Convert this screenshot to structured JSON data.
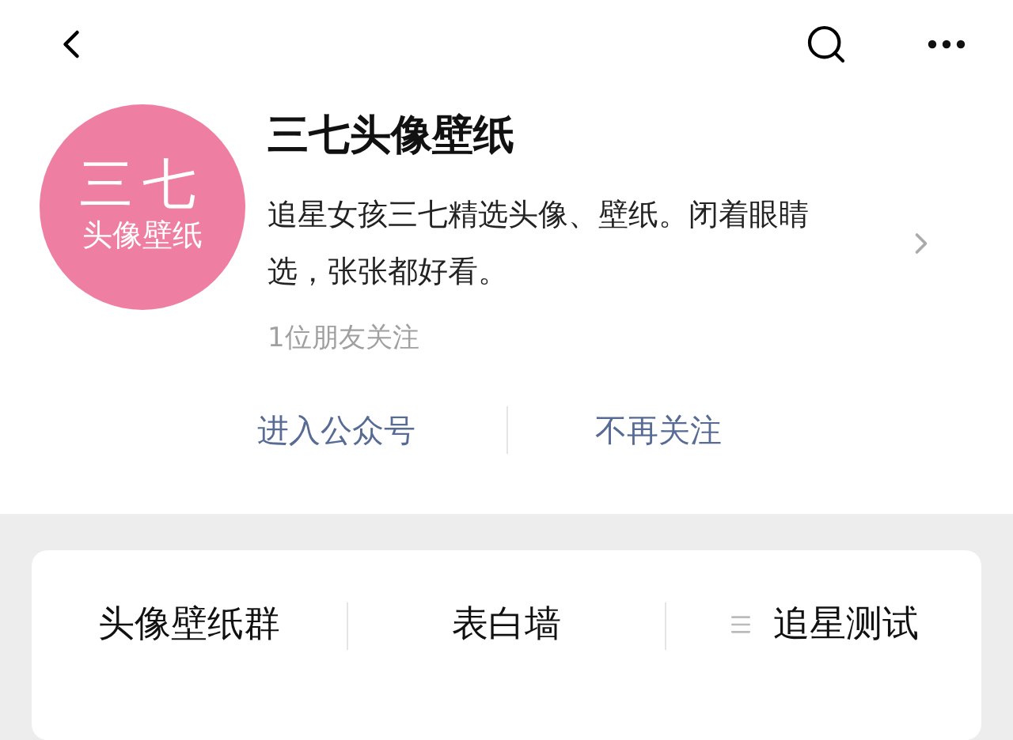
{
  "account": {
    "logo_line_1": "三七",
    "logo_line_2": "头像壁纸",
    "name": "三七头像壁纸",
    "description": "追星女孩三七精选头像、壁纸。闭着眼睛选，张张都好看。",
    "followers": "1位朋友关注"
  },
  "actions": [
    "进入公众号",
    "不再关注"
  ],
  "menu": [
    {
      "label": "头像壁纸群",
      "submenu": false
    },
    {
      "label": "表白墙",
      "submenu": false
    },
    {
      "label": "追星测试",
      "submenu": true
    }
  ]
}
